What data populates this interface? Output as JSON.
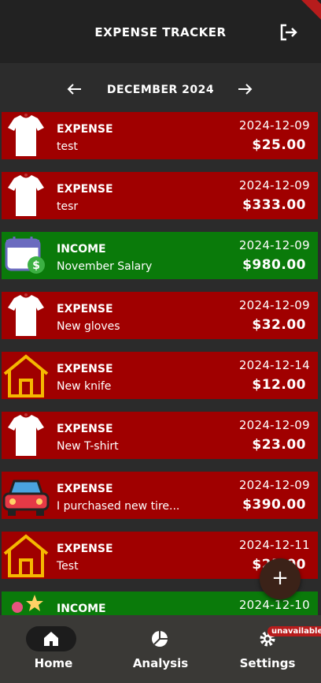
{
  "app": {
    "title": "EXPENSE TRACKER"
  },
  "month_nav": {
    "label": "DECEMBER 2024"
  },
  "transactions": [
    {
      "type": "EXPENSE",
      "description": "test",
      "date": "2024-12-09",
      "amount": "$25.00",
      "icon": "tshirt-icon"
    },
    {
      "type": "EXPENSE",
      "description": "tesr",
      "date": "2024-12-09",
      "amount": "$333.00",
      "icon": "tshirt-icon"
    },
    {
      "type": "INCOME",
      "description": "November Salary",
      "date": "2024-12-09",
      "amount": "$980.00",
      "icon": "calendar-money-icon"
    },
    {
      "type": "EXPENSE",
      "description": "New gloves",
      "date": "2024-12-09",
      "amount": "$32.00",
      "icon": "tshirt-icon"
    },
    {
      "type": "EXPENSE",
      "description": "New knife",
      "date": "2024-12-14",
      "amount": "$12.00",
      "icon": "house-icon"
    },
    {
      "type": "EXPENSE",
      "description": "New T-shirt",
      "date": "2024-12-09",
      "amount": "$23.00",
      "icon": "tshirt-icon"
    },
    {
      "type": "EXPENSE",
      "description": "I purchased new tire...",
      "date": "2024-12-09",
      "amount": "$390.00",
      "icon": "car-icon"
    },
    {
      "type": "EXPENSE",
      "description": "Test",
      "date": "2024-12-11",
      "amount": "$25.00",
      "icon": "house-icon"
    },
    {
      "type": "INCOME",
      "description": "",
      "date": "2024-12-10",
      "amount": "",
      "icon": "gift-icon"
    }
  ],
  "fab": {
    "label": "+"
  },
  "bottom_nav": {
    "items": [
      {
        "label": "Home",
        "icon": "home-icon"
      },
      {
        "label": "Analysis",
        "icon": "pie-chart-icon"
      },
      {
        "label": "Settings",
        "icon": "gear-icon"
      }
    ],
    "badge": "unavailable"
  },
  "colors": {
    "expense": "#a00000",
    "income": "#0a7a0a",
    "appbar": "#222222",
    "bottom_nav": "#3a3936"
  }
}
